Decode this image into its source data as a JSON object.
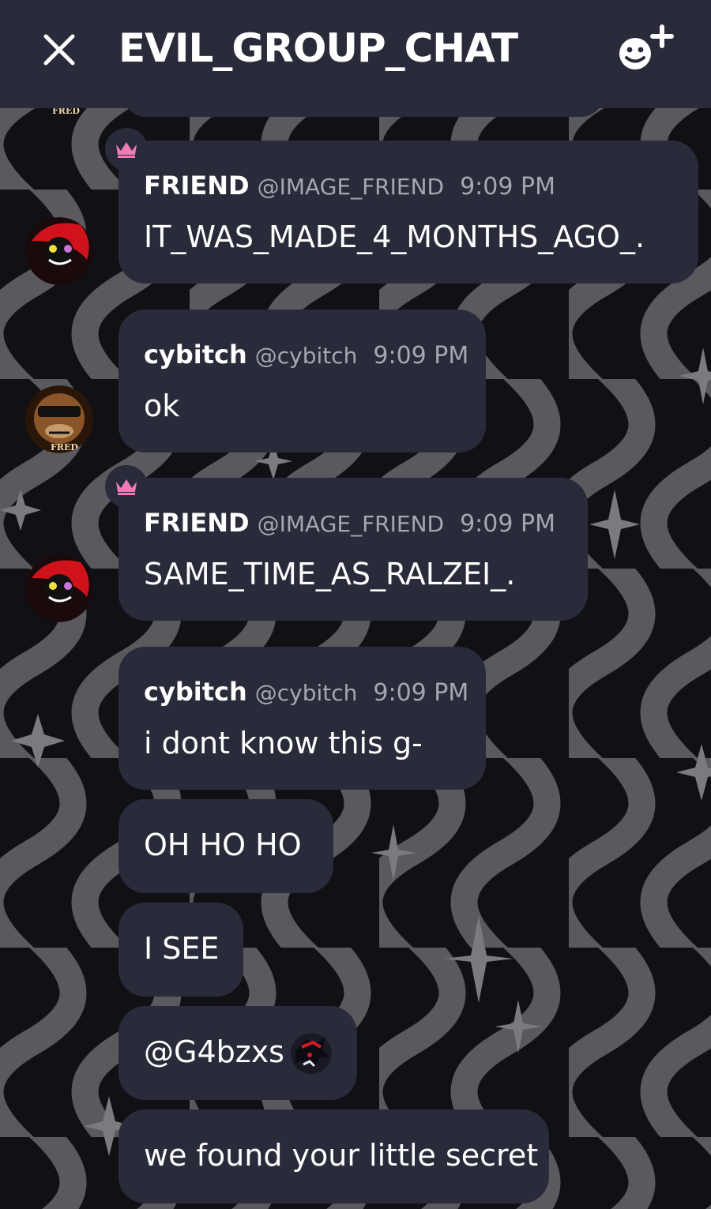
{
  "header": {
    "title": "EVIL_GROUP_CHAT",
    "close_icon": "close-icon",
    "add_icon": "add-member-icon"
  },
  "colors": {
    "header_bg": "#2a2b3a",
    "bubble_bg": "#2a2b3a",
    "mention": "#ef7fc0",
    "crown": "#f07ab8",
    "muted_text": "#a6a6b4"
  },
  "messages": [
    {
      "author": "FRIEND",
      "handle": "@IMAGE_FRIEND",
      "time": "9:09 PM",
      "text": "IT_WAS_MADE_4_MONTHS_AGO_.",
      "badge": "crown-icon"
    },
    {
      "author": "cybitch",
      "handle": "@cybitch",
      "time": "9:09 PM",
      "text": "ok"
    },
    {
      "author": "FRIEND",
      "handle": "@IMAGE_FRIEND",
      "time": "9:09 PM",
      "text": "SAME_TIME_AS_RALZEI_.",
      "badge": "crown-icon"
    },
    {
      "author": "cybitch",
      "handle": "@cybitch",
      "time": "9:09 PM",
      "text": "i dont know this g-"
    },
    {
      "text": "OH HO HO"
    },
    {
      "text": "I SEE"
    },
    {
      "mention": "@G4bzxs"
    },
    {
      "text": "we found your little secret"
    }
  ],
  "avatar_label": "FRED"
}
